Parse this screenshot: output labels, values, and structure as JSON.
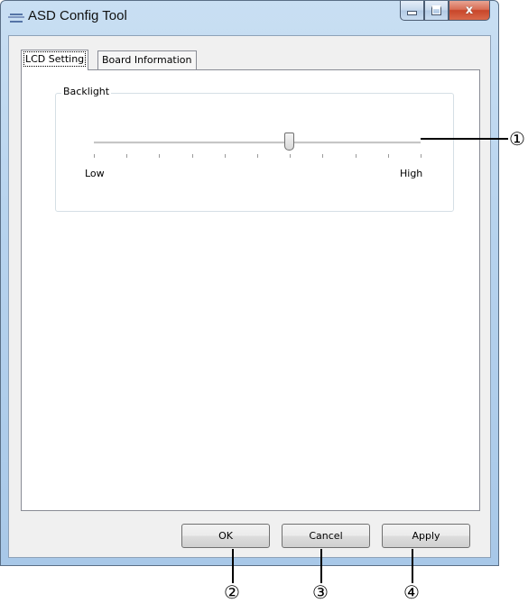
{
  "window": {
    "title": "ASD Config Tool",
    "close_glyph": "x"
  },
  "tabs": [
    {
      "label": "LCD Setting",
      "active": true
    },
    {
      "label": "Board Information",
      "active": false
    }
  ],
  "backlight": {
    "group_label": "Backlight",
    "low_label": "Low",
    "high_label": "High",
    "tick_count": 11,
    "level_fraction": 0.6
  },
  "buttons": {
    "ok": "OK",
    "cancel": "Cancel",
    "apply": "Apply"
  },
  "callouts": {
    "slider": "①",
    "ok": "②",
    "cancel": "③",
    "apply": "④"
  },
  "icons": [
    "window-icon",
    "minimize-icon",
    "maximize-icon",
    "close-icon"
  ],
  "colors": {
    "title_bar": "#b7d3ee",
    "close_button": "#c8462a",
    "dialog_background": "#f0f0f0"
  }
}
